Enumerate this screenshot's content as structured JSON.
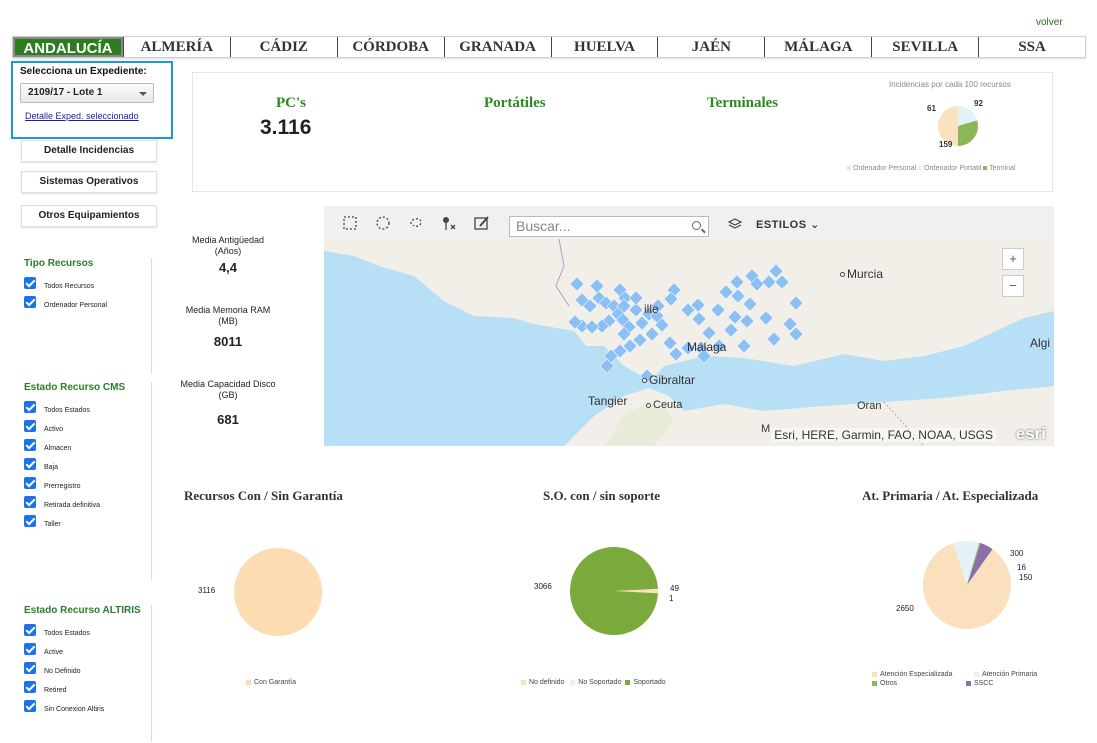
{
  "header": {
    "volver": "volver"
  },
  "tabs": [
    "ANDALUCÍA",
    "ALMERÍA",
    "CÁDIZ",
    "CÓRDOBA",
    "GRANADA",
    "HUELVA",
    "JAÉN",
    "MÁLAGA",
    "SEVILLA",
    "SSA"
  ],
  "active_tab": "ANDALUCÍA",
  "colors": {
    "accent_green": "#2c7d1e",
    "highlight_blue": "#1a9bd7",
    "map_marker": "#8cc0f5"
  },
  "expediente": {
    "label": "Selecciona un Expediente:",
    "selected": "2109/17 - Lote 1",
    "detail_link": "Detalle Exped. seleccionado"
  },
  "side_buttons": [
    "Detalle Incidencias",
    "Sistemas Operativos",
    "Otros Equipamientos"
  ],
  "filters": {
    "tipo_recursos": {
      "title": "Tipo Recursos",
      "items": [
        "Todos Recursos",
        "Ordenador Personal"
      ]
    },
    "estado_cms": {
      "title": "Estado Recurso CMS",
      "items": [
        "Todos Estados",
        "Activo",
        "Almacen",
        "Baja",
        "Prerregistro",
        "Retirada definitiva",
        "Taller"
      ]
    },
    "estado_altiris": {
      "title": "Estado Recurso ALTIRIS",
      "items": [
        "Todos Estados",
        "Active",
        "No Definido",
        "Retired",
        "Sin Conexion Altiris"
      ]
    }
  },
  "kpis": {
    "pcs": {
      "label": "PC's",
      "value": "3.116"
    },
    "portatiles": {
      "label": "Portátiles"
    },
    "terminales": {
      "label": "Terminales"
    }
  },
  "stats": [
    {
      "label": "Media Antigüedad",
      "unit": "(Años)",
      "value": "4,4"
    },
    {
      "label": "Media Memoria RAM",
      "unit": "(MB)",
      "value": "8011"
    },
    {
      "label": "Media Capacidad Disco",
      "unit": "(GB)",
      "value": "681"
    }
  ],
  "map": {
    "search_placeholder": "Buscar...",
    "styles_label": "ESTILOS",
    "zoom_in": "+",
    "zoom_out": "−",
    "attribution": "Esri, HERE, Garmin, FAO, NOAA, USGS",
    "logo": "esri",
    "cities": {
      "murcia": "Murcia",
      "sevilla": "ille",
      "malaga": "Málaga",
      "gibraltar": "Gibraltar",
      "tangier": "Tangier",
      "ceuta": "Ceuta",
      "oran": "Oran",
      "algiers": "Algi",
      "melilla": "M"
    },
    "tools": [
      "rectangle-select-icon",
      "circle-select-icon",
      "lasso-select-icon",
      "clear-selection-icon",
      "edit-icon",
      "layers-icon"
    ]
  },
  "chart_data": [
    {
      "type": "pie",
      "title": "Incidencias por cada 100 recursos",
      "categories": [
        "Ordenador Personal",
        "Ordenador Portatil",
        "Terminal"
      ],
      "values": [
        159,
        61,
        92
      ],
      "colors": [
        "#fbe2bf",
        "#e3f1f8",
        "#8db55a"
      ]
    },
    {
      "type": "pie",
      "title": "Recursos Con / Sin Garantía",
      "categories": [
        "Con Garantía"
      ],
      "values": [
        3116
      ],
      "colors": [
        "#fcdcb0"
      ]
    },
    {
      "type": "pie",
      "title": "S.O. con / sin soporte",
      "categories": [
        "No definido",
        "No Soportado",
        "Soportado"
      ],
      "values": [
        49,
        1,
        3066
      ],
      "colors": [
        "#fbe0b8",
        "#e4f2f8",
        "#7aaa3c"
      ]
    },
    {
      "type": "pie",
      "title": "At. Primaria / At. Especializada",
      "categories": [
        "Atención Especializada",
        "Atención Primaria",
        "Otros",
        "SSCC"
      ],
      "values": [
        2650,
        300,
        16,
        150
      ],
      "colors": [
        "#fbe0bd",
        "#e4f2f8",
        "#8db55a",
        "#8a6fa8"
      ]
    }
  ]
}
